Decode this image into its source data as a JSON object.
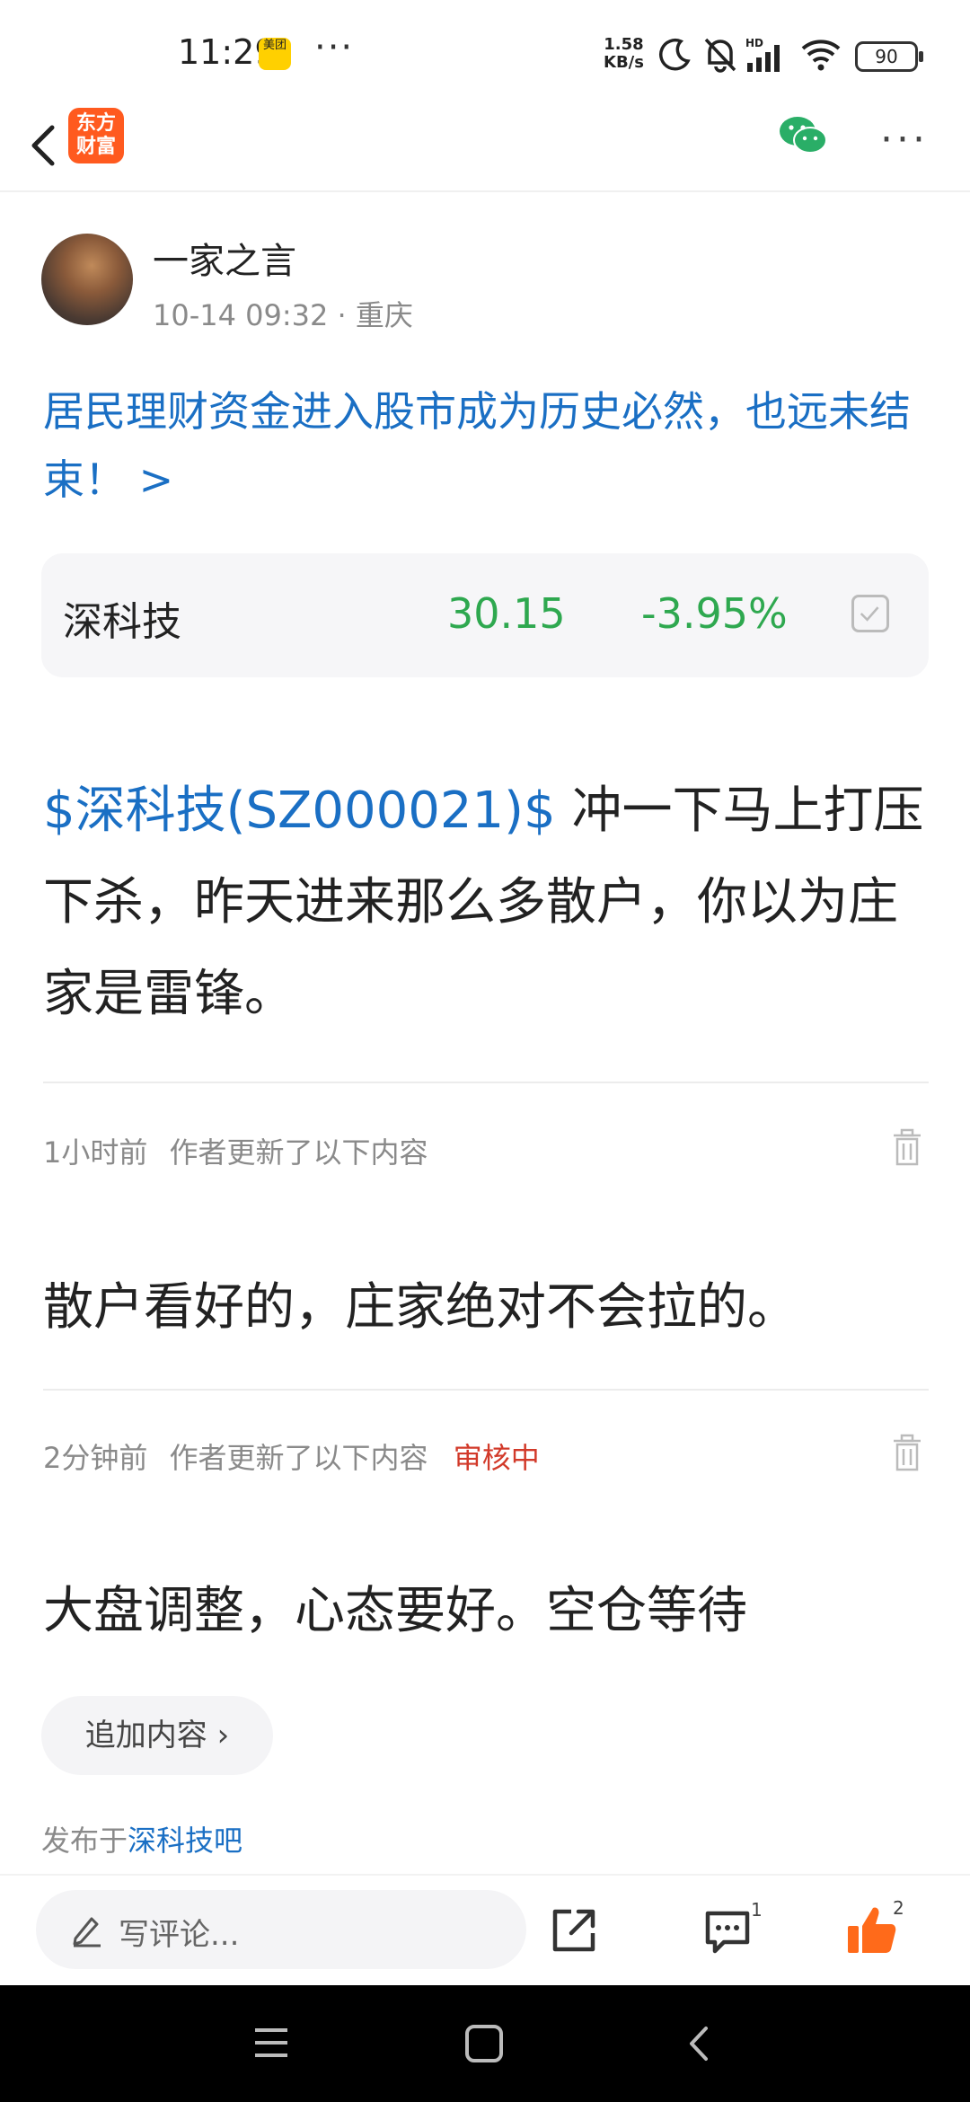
{
  "status_bar": {
    "time": "11:29",
    "app_badge": "美团",
    "overflow": "···",
    "net_speed_value": "1.58",
    "net_speed_unit": "KB/s",
    "battery": "90",
    "icons": [
      "moon-icon",
      "mute-bell-icon",
      "signal-hd-icon",
      "wifi-icon",
      "battery-icon"
    ]
  },
  "nav": {
    "logo_line1": "东方",
    "logo_line2": "财富",
    "more": "···"
  },
  "author": {
    "name": "一家之言",
    "meta": "10-14 09:32 · 重庆"
  },
  "post": {
    "title": "居民理财资金进入股市成为历史必然，也远未结束！ >",
    "stock": {
      "name": "深科技",
      "price": "30.15",
      "change": "-3.95%",
      "color": "#2ea84f"
    },
    "body_tag": "$深科技(SZ000021)$",
    "body_text": " 冲一下马上打压下杀，昨天进来那么多散户，你以为庄家是雷锋。"
  },
  "updates": [
    {
      "time": "1小时前",
      "label": "作者更新了以下内容",
      "status": "",
      "text": "散户看好的，庄家绝对不会拉的。"
    },
    {
      "time": "2分钟前",
      "label": "作者更新了以下内容",
      "status": "审核中",
      "text": "大盘调整，心态要好。空仓等待"
    }
  ],
  "append_button": "追加内容 ›",
  "published": {
    "prefix": "发布于",
    "bar": "深科技吧"
  },
  "actions": {
    "comment_placeholder": "写评论...",
    "comment_count": "1",
    "like_count": "2"
  },
  "colors": {
    "link_blue": "#1a6fc4",
    "accent_orange": "#ff5a1f",
    "review_red": "#d23a2a"
  }
}
